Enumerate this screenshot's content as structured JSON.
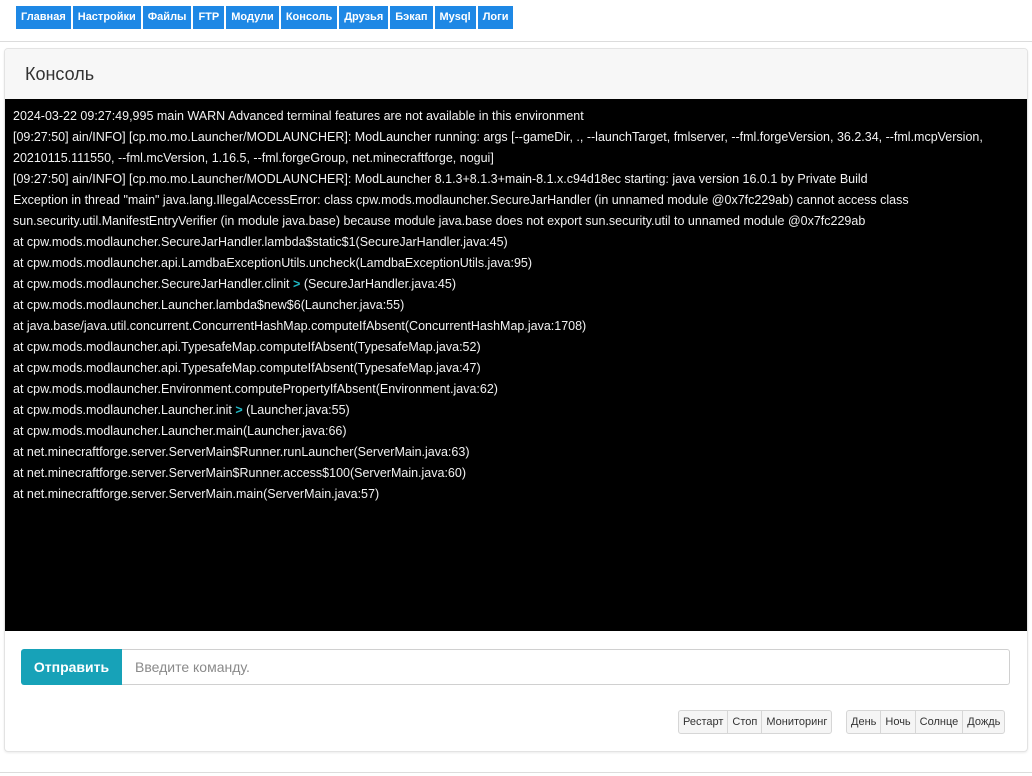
{
  "nav": {
    "items": [
      "Главная",
      "Настройки",
      "Файлы",
      "FTP",
      "Модули",
      "Консоль",
      "Друзья",
      "Бэкап",
      "Mysql",
      "Логи"
    ],
    "color": "#1e88e5"
  },
  "panel": {
    "title": "Консоль"
  },
  "console": {
    "background": "#000000",
    "lines": [
      "2024-03-22 09:27:49,995 main WARN Advanced terminal features are not available in this environment",
      "[09:27:50] ain/INFO] [cp.mo.mo.Launcher/MODLAUNCHER]: ModLauncher running: args [--gameDir, ., --launchTarget, fmlserver, --fml.forgeVersion, 36.2.34, --fml.mcpVersion, 20210115.111550, --fml.mcVersion, 1.16.5, --fml.forgeGroup, net.minecraftforge, nogui]",
      "[09:27:50] ain/INFO] [cp.mo.mo.Launcher/MODLAUNCHER]: ModLauncher 8.1.3+8.1.3+main-8.1.x.c94d18ec starting: java version 16.0.1 by Private Build",
      "Exception in thread \"main\" java.lang.IllegalAccessError: class cpw.mods.modlauncher.SecureJarHandler (in unnamed module @0x7fc229ab) cannot access class sun.security.util.ManifestEntryVerifier (in module java.base) because module java.base does not export sun.security.util to unnamed module @0x7fc229ab",
      "at cpw.mods.modlauncher.SecureJarHandler.lambda$static$1(SecureJarHandler.java:45)",
      "at cpw.mods.modlauncher.api.LamdbaExceptionUtils.uncheck(LamdbaExceptionUtils.java:95)",
      "at cpw.mods.modlauncher.SecureJarHandler.clinit",
      "at cpw.mods.modlauncher.Launcher.lambda$new$6(Launcher.java:55)",
      "at java.base/java.util.concurrent.ConcurrentHashMap.computeIfAbsent(ConcurrentHashMap.java:1708)",
      "at cpw.mods.modlauncher.api.TypesafeMap.computeIfAbsent(TypesafeMap.java:52)",
      "at cpw.mods.modlauncher.api.TypesafeMap.computeIfAbsent(TypesafeMap.java:47)",
      "at cpw.mods.modlauncher.Environment.computePropertyIfAbsent(Environment.java:62)",
      "at cpw.mods.modlauncher.Launcher.init",
      "at cpw.mods.modlauncher.Launcher.main(Launcher.java:66)",
      "at net.minecraftforge.server.ServerMain$Runner.runLauncher(ServerMain.java:63)",
      "at net.minecraftforge.server.ServerMain$Runner.access$100(ServerMain.java:60)",
      "at net.minecraftforge.server.ServerMain.main(ServerMain.java:57)"
    ],
    "line7_arrow": ">",
    "line7_tail": "(SecureJarHandler.java:45)",
    "line13_arrow": ">",
    "line13_tail": "(Launcher.java:55)",
    "arrow_color": "#1fb8c4"
  },
  "command": {
    "send_label": "Отправить",
    "placeholder": "Введите команду.",
    "value": "",
    "accent": "#17a2b8"
  },
  "controls": {
    "server": [
      "Рестарт",
      "Стоп",
      "Мониторинг"
    ],
    "world": [
      "День",
      "Ночь",
      "Солнце",
      "Дождь"
    ]
  }
}
